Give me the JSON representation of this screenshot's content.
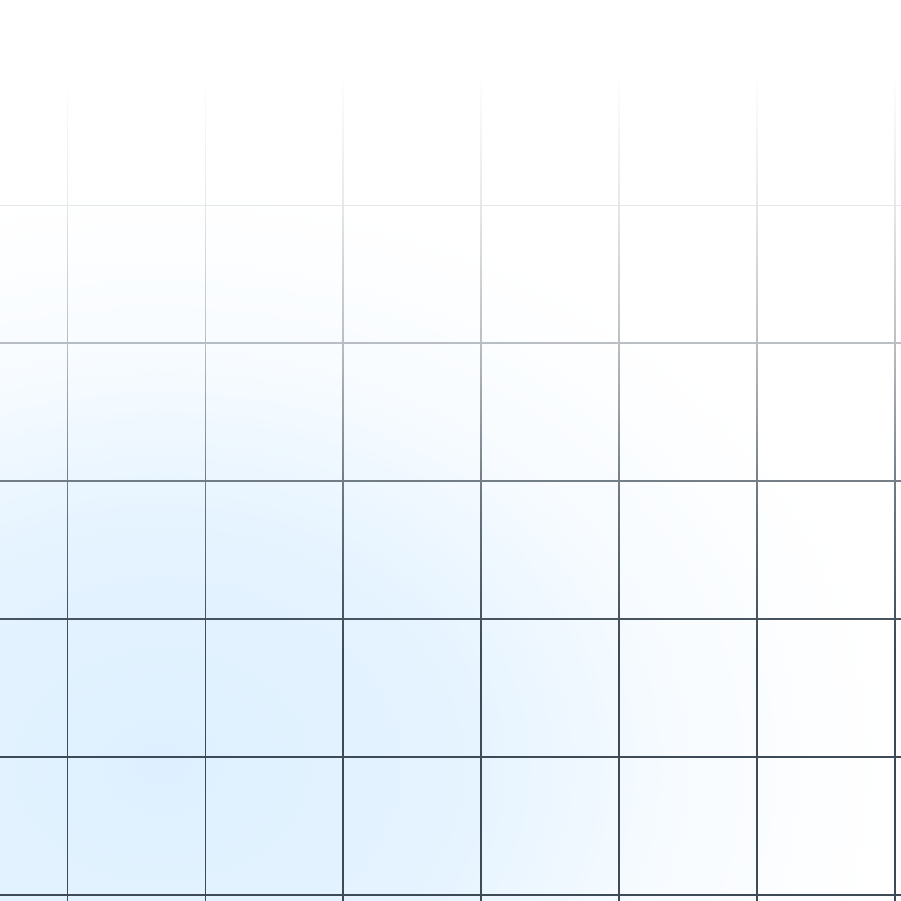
{
  "background": {
    "base_color": "#ffffff",
    "glow_color": "#e0f0ff",
    "line_color": "#3e4a55"
  },
  "grid": {
    "columns": 7,
    "rows": 7
  }
}
